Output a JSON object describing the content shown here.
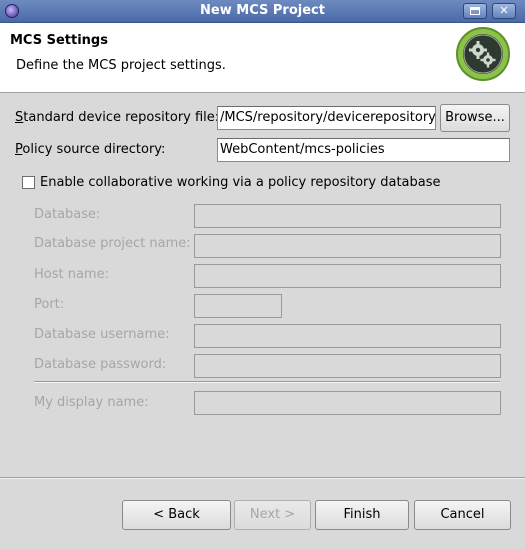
{
  "window": {
    "title": "New MCS Project"
  },
  "header": {
    "title": "MCS Settings",
    "description": "Define the MCS project settings."
  },
  "form": {
    "repo_label": "Standard device repository file:",
    "repo_value": "/MCS/repository/devicerepository/c",
    "browse_label": "Browse...",
    "policy_label": "Policy source directory:",
    "policy_value": "WebContent/mcs-policies",
    "collab_label": "Enable collaborative working via a policy repository database",
    "collab_checked": false,
    "database_label": "Database:",
    "db_project_label": "Database project name:",
    "host_label": "Host name:",
    "port_label": "Port:",
    "db_user_label": "Database username:",
    "db_pass_label": "Database password:",
    "display_name_label": "My display name:"
  },
  "buttons": {
    "back": "< Back",
    "next": "Next >",
    "finish": "Finish",
    "cancel": "Cancel"
  }
}
